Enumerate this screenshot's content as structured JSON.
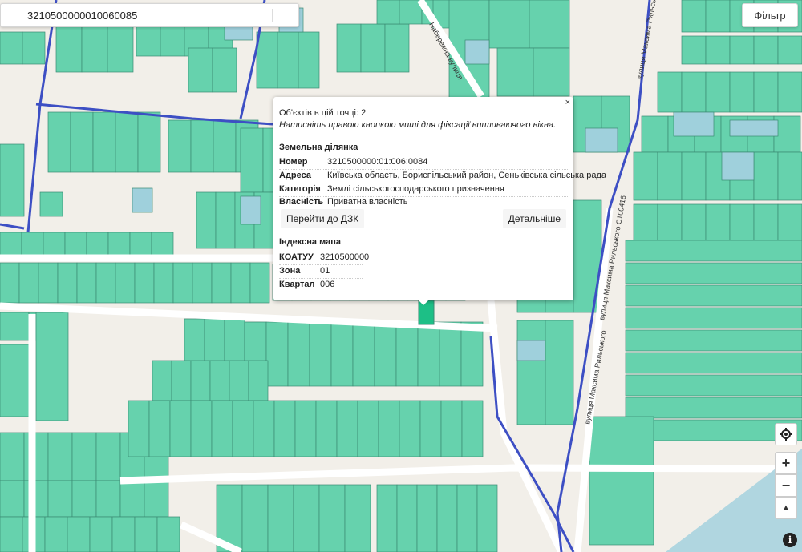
{
  "search": {
    "value": "3210500000010060085",
    "placeholder": ""
  },
  "filter_button": {
    "label": "Фільтр"
  },
  "map": {
    "streets": [
      "вулиця Максима Рильського",
      "вулиця Максима Рильського С100416",
      "вулиця Максима Рильського",
      "Набережна вулиця"
    ],
    "colors": {
      "parcel": "#66d2ad",
      "parcel_border": "#3b8a73",
      "boundary": "#3d4fc4",
      "road": "#ffffff",
      "background": "#f2efe9",
      "water": "#a9d3df",
      "highlight": "#1dbf86"
    }
  },
  "popup": {
    "close": "×",
    "objects_count_text": "Об'єктів в цій точці: 2",
    "hint": "Натисніть правою кнопкою миші для фіксації випливаючого вікна.",
    "parcel_section_title": "Земельна ділянка",
    "parcel_rows": [
      {
        "key": "Номер",
        "value": "3210500000:01:006:0084"
      },
      {
        "key": "Адреса",
        "value": "Київська область, Бориспільський район, Сеньківська сільська рада"
      },
      {
        "key": "Категорія",
        "value": "Землі сільськогосподарського призначення"
      },
      {
        "key": "Власність",
        "value": "Приватна власність"
      }
    ],
    "go_to_dzk": "Перейти до ДЗК",
    "details": "Детальніше",
    "index_section_title": "Індексна мапа",
    "index_rows": [
      {
        "key": "КОАТУУ",
        "value": "3210500000"
      },
      {
        "key": "Зона",
        "value": "01"
      },
      {
        "key": "Квартал",
        "value": "006"
      }
    ]
  },
  "controls": {
    "locate_icon": "crosshair-icon",
    "zoom_in": "+",
    "zoom_out": "−",
    "compass": "▲",
    "info": "i"
  }
}
